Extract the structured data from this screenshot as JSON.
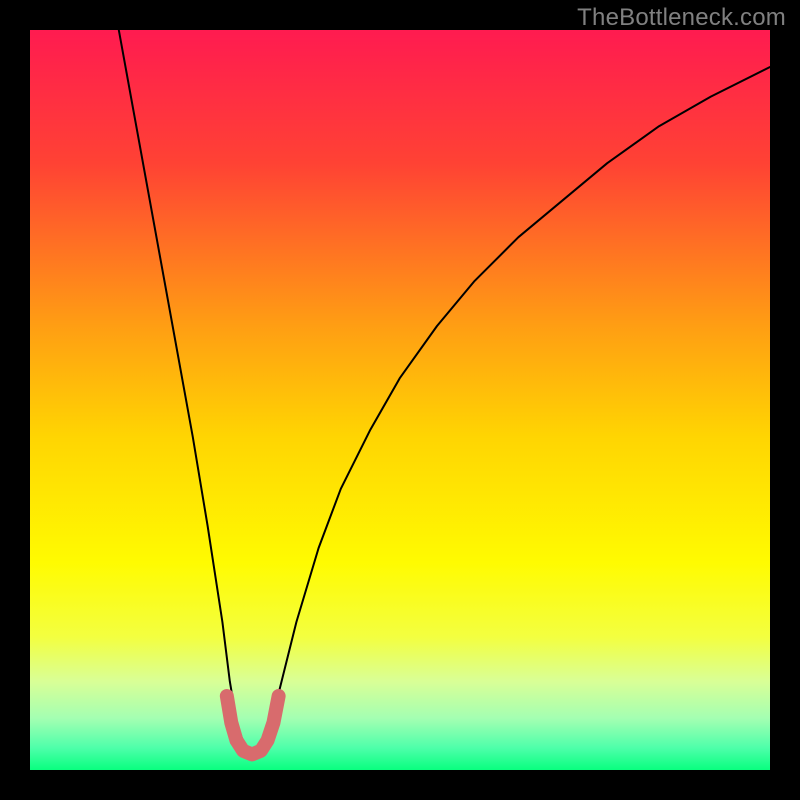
{
  "watermark": "TheBottleneck.com",
  "chart_data": {
    "type": "line",
    "title": "",
    "xlabel": "",
    "ylabel": "",
    "xlim": [
      0,
      100
    ],
    "ylim": [
      0,
      100
    ],
    "background_gradient": {
      "stops": [
        {
          "offset": 0.0,
          "color": "#ff1b50"
        },
        {
          "offset": 0.18,
          "color": "#ff4234"
        },
        {
          "offset": 0.4,
          "color": "#ff9e13"
        },
        {
          "offset": 0.55,
          "color": "#ffd502"
        },
        {
          "offset": 0.72,
          "color": "#fffb01"
        },
        {
          "offset": 0.82,
          "color": "#f3ff40"
        },
        {
          "offset": 0.88,
          "color": "#d9ff96"
        },
        {
          "offset": 0.93,
          "color": "#a4ffb2"
        },
        {
          "offset": 0.97,
          "color": "#4effaa"
        },
        {
          "offset": 1.0,
          "color": "#09ff7f"
        }
      ]
    },
    "series": [
      {
        "name": "bottleneck-curve",
        "stroke": "#000000",
        "stroke_width": 2,
        "x": [
          12,
          14,
          16,
          18,
          20,
          22,
          24,
          26,
          27,
          28,
          29.5,
          31,
          32.5,
          34,
          36,
          39,
          42,
          46,
          50,
          55,
          60,
          66,
          72,
          78,
          85,
          92,
          100
        ],
        "values": [
          100,
          89,
          78,
          67,
          56,
          45,
          33,
          20,
          12,
          6,
          2,
          2,
          6,
          12,
          20,
          30,
          38,
          46,
          53,
          60,
          66,
          72,
          77,
          82,
          87,
          91,
          95
        ]
      },
      {
        "name": "optimal-marker",
        "stroke": "#d86b6d",
        "stroke_width": 14,
        "x": [
          26.6,
          27.2,
          27.9,
          28.8,
          30.0,
          31.2,
          32.1,
          32.9,
          33.6
        ],
        "values": [
          10.0,
          6.4,
          4.0,
          2.6,
          2.1,
          2.6,
          4.0,
          6.4,
          10.0
        ]
      }
    ]
  }
}
